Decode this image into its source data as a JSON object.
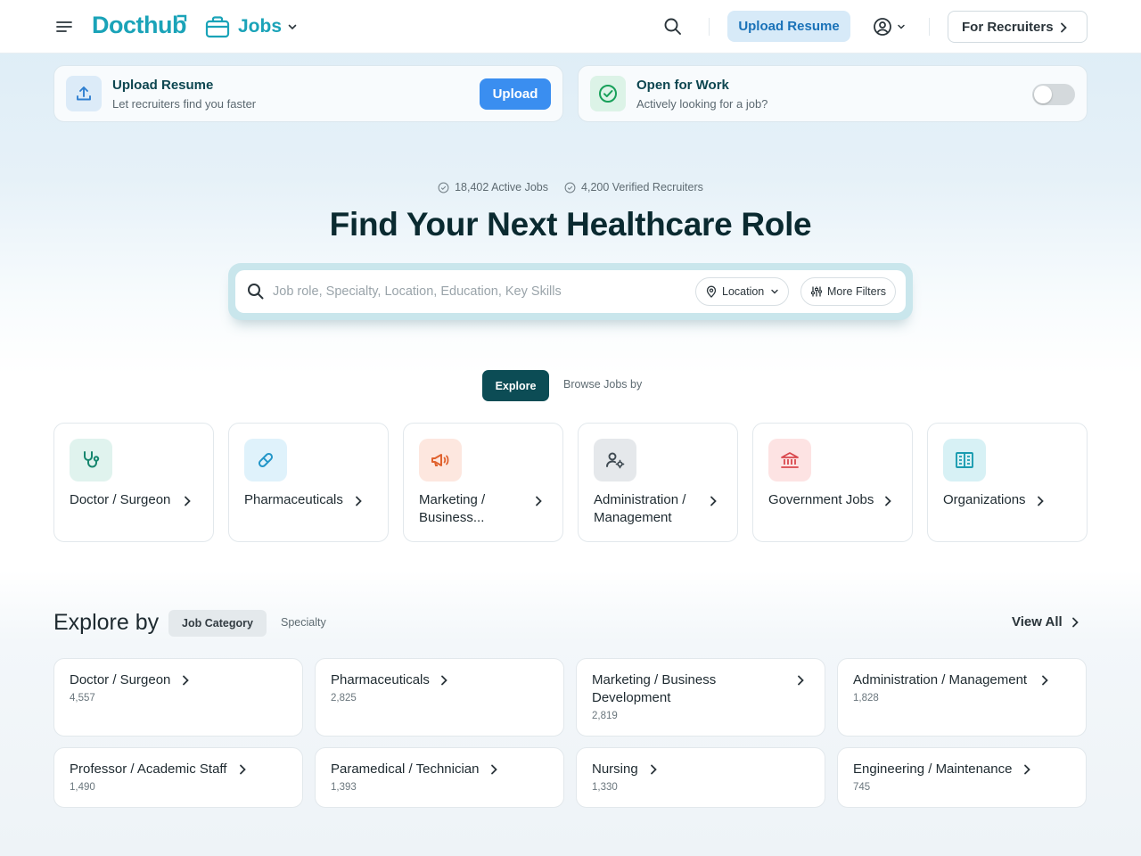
{
  "header": {
    "logo": "Docthub",
    "product": "Jobs",
    "upload_resume": "Upload Resume",
    "for_recruiters": "For Recruiters"
  },
  "top_cards": {
    "upload": {
      "title": "Upload Resume",
      "subtitle": "Let recruiters find you faster",
      "button": "Upload"
    },
    "open_for_work": {
      "title": "Open for Work",
      "subtitle": "Actively looking for a job?",
      "enabled": false
    }
  },
  "hero": {
    "active_jobs": "18,402 Active Jobs",
    "verified_recruiters": "4,200 Verified Recruiters",
    "title": "Find Your Next Healthcare Role",
    "search_placeholder": "Job role, Specialty, Location, Education, Key Skills",
    "location_label": "Location",
    "more_filters_label": "More Filters"
  },
  "browse": {
    "explore_tab": "Explore",
    "browse_tab": "Browse Jobs by"
  },
  "categories": [
    {
      "label": "Doctor / Surgeon",
      "icon": "stethoscope-icon",
      "bg": "#e0f3ee",
      "color": "#16866e"
    },
    {
      "label": "Pharmaceuticals",
      "icon": "pill-icon",
      "bg": "#dff2fb",
      "color": "#2296c8"
    },
    {
      "label": "Marketing / Business...",
      "icon": "megaphone-icon",
      "bg": "#fde7df",
      "color": "#e0622e"
    },
    {
      "label": "Administration / Management",
      "icon": "user-gear-icon",
      "bg": "#e5e8eb",
      "color": "#3f4a52"
    },
    {
      "label": "Government Jobs",
      "icon": "bank-icon",
      "bg": "#fde3e3",
      "color": "#d9484d"
    },
    {
      "label": "Organizations",
      "icon": "building-icon",
      "bg": "#d7f1f5",
      "color": "#1a9cb0"
    }
  ],
  "explore_by": {
    "title": "Explore by",
    "tab_active": "Job Category",
    "tab_inactive": "Specialty",
    "view_all": "View All",
    "items": [
      {
        "name": "Doctor / Surgeon",
        "count": "4,557"
      },
      {
        "name": "Pharmaceuticals",
        "count": "2,825"
      },
      {
        "name": "Marketing / Business Development",
        "count": "2,819"
      },
      {
        "name": "Administration / Management",
        "count": "1,828"
      },
      {
        "name": "Professor / Academic Staff",
        "count": "1,490"
      },
      {
        "name": "Paramedical / Technician",
        "count": "1,393"
      },
      {
        "name": "Nursing",
        "count": "1,330"
      },
      {
        "name": "Engineering / Maintenance",
        "count": "745"
      }
    ]
  }
}
